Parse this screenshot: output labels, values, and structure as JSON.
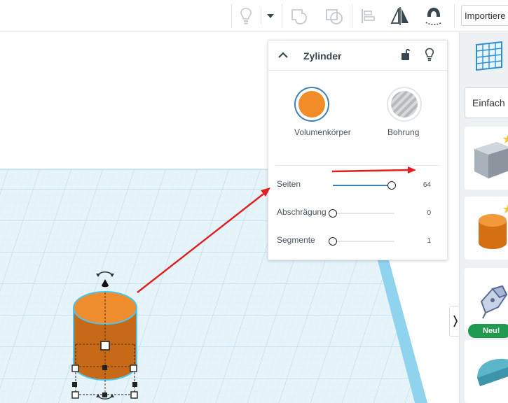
{
  "toolbar": {
    "import_label": "Importiere",
    "icons": [
      "lightbulb-icon",
      "dropdown-icon",
      "group-icon",
      "ungroup-icon",
      "align-icon",
      "mirror-icon",
      "magnet-icon"
    ]
  },
  "inspector": {
    "title": "Zylinder",
    "solid_label": "Volumenkörper",
    "hole_label": "Bohrung",
    "solid_color": "#f28c28",
    "properties": [
      {
        "label": "Seiten",
        "value": "64",
        "level": 0.95
      },
      {
        "label": "Abschrägung",
        "value": "0",
        "level": 0.0
      },
      {
        "label": "Segmente",
        "value": "1",
        "level": 0.0
      }
    ]
  },
  "sidebar": {
    "category_label": "Einfach",
    "new_badge": "Neu!",
    "tiles": [
      "grid-shape-icon",
      "box-shape-icon",
      "cylinder-shape-icon",
      "scribble-shape-icon",
      "half-cylinder-shape-icon"
    ]
  },
  "colors": {
    "accent": "#3d82b5",
    "workplane_grid": "#cde8f2",
    "workplane_edge": "#7cc8e8",
    "cylinder": "#e57c1c",
    "annotation_arrow": "#e31e1e",
    "new_badge": "#1f9a4f"
  }
}
